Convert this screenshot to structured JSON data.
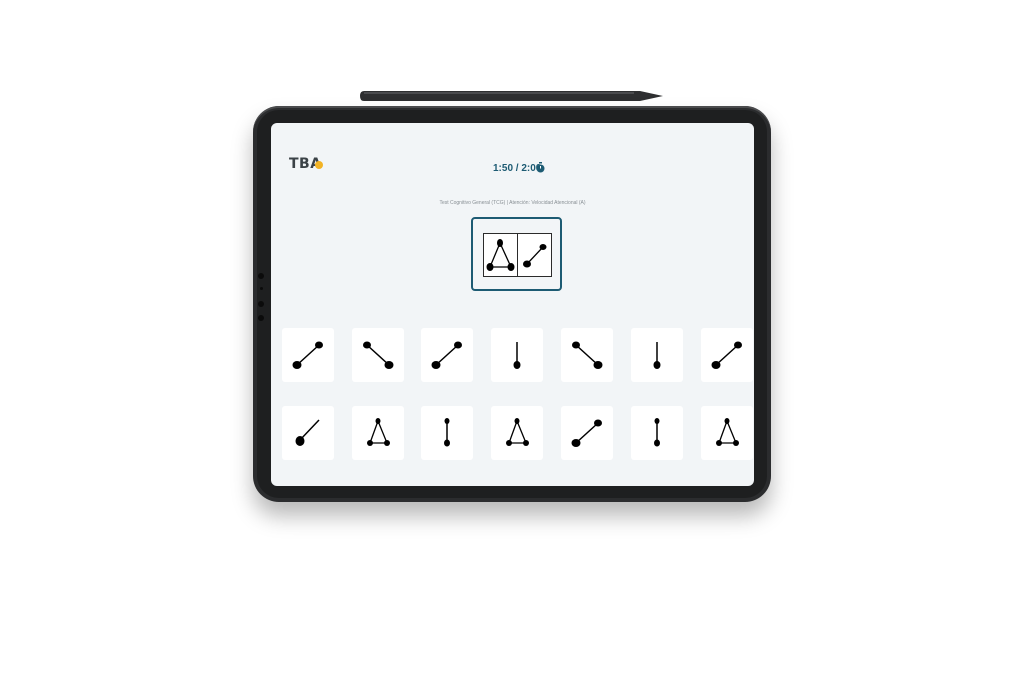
{
  "app": {
    "logo_text": "TBA"
  },
  "header": {
    "timer": "1:50 / 2:00",
    "timer_icon": "stopwatch-icon",
    "accent_color": "#1d5b73"
  },
  "test": {
    "title": "Test Cognitivo General (TCG) | Atención: Velocidad Atencional (A)"
  },
  "target": {
    "figures": [
      "triangle",
      "diagonal-right"
    ]
  },
  "options": {
    "row1": [
      "diagonal-right",
      "diagonal-left",
      "diagonal-right",
      "vertical-dot-bottom",
      "diagonal-left",
      "vertical-dot-bottom",
      "diagonal-right"
    ],
    "row2": [
      "diagonal-right-single",
      "triangle",
      "vertical-two-dots",
      "triangle",
      "diagonal-right",
      "vertical-two-dots",
      "triangle"
    ]
  }
}
